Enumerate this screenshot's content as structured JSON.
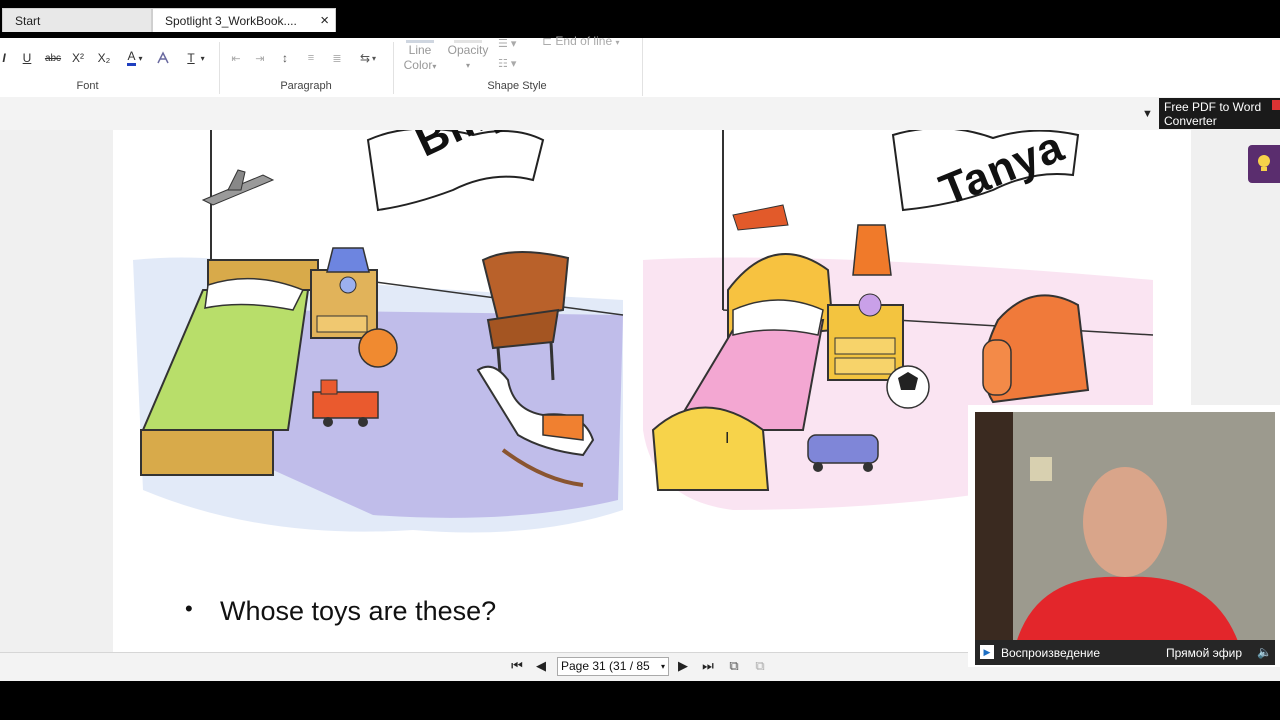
{
  "ribbon": {
    "font_group": "Font",
    "paragraph_group": "Paragraph",
    "shape_style_group": "Shape Style",
    "underline": "U",
    "strike": "abc",
    "superscript": "X²",
    "subscript": "X₂",
    "font_color_letter": "A",
    "line_color": "Line",
    "line_color_2": "Color",
    "opacity": "Opacity",
    "end_of_line": "End of line"
  },
  "ad": {
    "line1": "Free PDF to Word",
    "line2": "Converter"
  },
  "tabs": {
    "start": "Start",
    "doc": "Spotlight 3_WorkBook....",
    "close": "×"
  },
  "page": {
    "banner_left": "Billy",
    "banner_right": "Tanya",
    "bullet": "•",
    "question": "Whose toys are these?"
  },
  "status": {
    "page_indicator": "Page 31 (31 / 85"
  },
  "webcam": {
    "playback": "Воспроизведение",
    "live": "Прямой эфир"
  },
  "colors": {
    "ribbon_bg": "#ffffff",
    "doc_bg": "#f0f0f0",
    "accent_purple": "#5a2d6e",
    "font_color_blue": "#1f3fbf"
  }
}
